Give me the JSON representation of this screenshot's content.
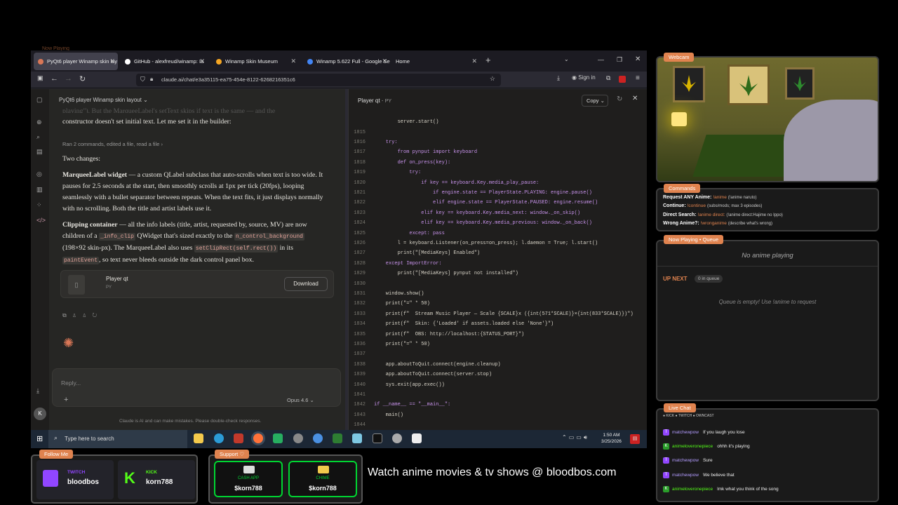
{
  "browser": {
    "tabs": [
      {
        "label": "PyQt6 player Winamp skin lay"
      },
      {
        "label": "GitHub - alexfreud/winamp: Ia"
      },
      {
        "label": "Winamp Skin Museum"
      },
      {
        "label": "Winamp 5.622 Full - Google Se"
      },
      {
        "label": "Home"
      }
    ],
    "url": "claude.ai/chat/e3a35115-ea75-454e-8122-6268216351c6",
    "sign_in": "Sign in",
    "new_tab": "+"
  },
  "claude": {
    "title": "PyQt6 player Winamp skin layout",
    "intro_line1": "playing\"). But the MarqueeLabel's setText skips if text is the same — and the",
    "intro_line2": "constructor doesn't set initial text. Let me set it in the builder:",
    "tool_summary": "Ran 2 commands, edited a file, read a file",
    "two_changes": "Two changes:",
    "p1_head": "MarqueeLabel widget",
    "p1_body": " — a custom QLabel subclass that auto-scrolls when text is too wide. It pauses for 2.5 seconds at the start, then smoothly scrolls at 1px per tick (20fps), looping seamlessly with a bullet separator between repeats. When the text fits, it just displays normally with no scrolling. Both the title and artist labels use it.",
    "p2_head": "Clipping container",
    "p2_a": " — all the info labels (title, artist, requested by, source, MV) are now children of a ",
    "p2_code1": "_info_clip",
    "p2_b": " QWidget that's sized exactly to the ",
    "p2_code2": "n_control_background",
    "p2_c": " (198×92 skin-px). The MarqueeLabel also uses ",
    "p2_code3": "setClipRect(self.rect())",
    "p2_d": " in its ",
    "p2_code4": "paintEvent",
    "p2_e": ", so text never bleeds outside the dark control panel box.",
    "file_name": "Player qt",
    "file_type": "PY",
    "download": "Download",
    "reply_placeholder": "Reply...",
    "model": "Opus 4.6",
    "disclaimer": "Claude is AI and can make mistakes. Please double-check responses."
  },
  "code_pane": {
    "title": "Player qt",
    "type": "PY",
    "copy": "Copy",
    "lines": [
      {
        "n": "",
        "t": "        server.start()"
      },
      {
        "n": "1815",
        "t": ""
      },
      {
        "n": "1816",
        "t": "    try:"
      },
      {
        "n": "1817",
        "t": "        from pynput import keyboard"
      },
      {
        "n": "1818",
        "t": "        def on_press(key):"
      },
      {
        "n": "1819",
        "t": "            try:"
      },
      {
        "n": "1820",
        "t": "                if key == keyboard.Key.media_play_pause:"
      },
      {
        "n": "1821",
        "t": "                    if engine.state == PlayerState.PLAYING: engine.pause()"
      },
      {
        "n": "1822",
        "t": "                    elif engine.state == PlayerState.PAUSED: engine.resume()"
      },
      {
        "n": "1823",
        "t": "                elif key == keyboard.Key.media_next: window._on_skip()"
      },
      {
        "n": "1824",
        "t": "                elif key == keyboard.Key.media_previous: window._on_back()"
      },
      {
        "n": "1825",
        "t": "            except: pass"
      },
      {
        "n": "1826",
        "t": "        l = keyboard.Listener(on_press=on_press); l.daemon = True; l.start()"
      },
      {
        "n": "1827",
        "t": "        print(\"[MediaKeys] Enabled\")"
      },
      {
        "n": "1828",
        "t": "    except ImportError:"
      },
      {
        "n": "1829",
        "t": "        print(\"[MediaKeys] pynput not installed\")"
      },
      {
        "n": "1830",
        "t": ""
      },
      {
        "n": "1831",
        "t": "    window.show()"
      },
      {
        "n": "1832",
        "t": "    print(\"=\" * 50)"
      },
      {
        "n": "1833",
        "t": "    print(f\"  Stream Music Player — Scale {SCALE}x ({int(571*SCALE)}×{int(833*SCALE)})\")"
      },
      {
        "n": "1834",
        "t": "    print(f\"  Skin: {'Loaded' if assets.loaded else 'None'}\")"
      },
      {
        "n": "1835",
        "t": "    print(f\"  OBS: http://localhost:{STATUS_PORT}\")"
      },
      {
        "n": "1836",
        "t": "    print(\"=\" * 50)"
      },
      {
        "n": "1837",
        "t": ""
      },
      {
        "n": "1838",
        "t": "    app.aboutToQuit.connect(engine.cleanup)"
      },
      {
        "n": "1839",
        "t": "    app.aboutToQuit.connect(server.stop)"
      },
      {
        "n": "1840",
        "t": "    sys.exit(app.exec())"
      },
      {
        "n": "1841",
        "t": ""
      },
      {
        "n": "1842",
        "t": "if __name__ == \"__main__\":"
      },
      {
        "n": "1843",
        "t": "    main()"
      },
      {
        "n": "1844",
        "t": ""
      }
    ]
  },
  "taskbar": {
    "search": "Type here to search",
    "time": "1:50 AM",
    "date": "3/25/2026"
  },
  "overlay": {
    "webcam_tag": "Webcam",
    "commands_tag": "Commands",
    "commands": [
      {
        "label": "Request ANY Anime:",
        "cmd": "!anime",
        "desc": "(!anime naruto)"
      },
      {
        "label": "Continue:",
        "cmd": "!continue",
        "desc": "(subs/mods; max 3 episodes)"
      },
      {
        "label": "Direct Search:",
        "cmd": "!anime direct:",
        "desc": "(!anime direct:Hajime no Ippo)"
      },
      {
        "label": "Wrong Anime?:",
        "cmd": "!wronganime",
        "desc": "(describe what's wrong)"
      }
    ],
    "now_playing_tag": "Now Playing • Queue",
    "now_playing": "No anime playing",
    "up_next": "UP NEXT",
    "queue_count": "0 in queue",
    "queue_empty": "Queue is empty! Use !anime to request",
    "live_chat_tag": "Live Chat",
    "chat_sources": "● KICK  ● TWITCH  ● OWNCAST",
    "chat": [
      {
        "platform": "twitch",
        "user": "matchewpow",
        "msg": "If you laugh you lose"
      },
      {
        "platform": "kick",
        "user": "animeloveronepiece",
        "msg": "ohhh it's playing"
      },
      {
        "platform": "twitch",
        "user": "matchewpow",
        "msg": "Sure"
      },
      {
        "platform": "twitch",
        "user": "matchewpow",
        "msg": "We believe that"
      },
      {
        "platform": "kick",
        "user": "animeloveronepiece",
        "msg": "lmk what you think of the song"
      }
    ],
    "follow_tag": "Follow Me",
    "twitch_label": "TWITCH",
    "twitch_user": "bloodbos",
    "kick_label": "KICK",
    "kick_user": "korn788",
    "support_tag": "Support ♡",
    "cashapp_label": "CASH APP",
    "cashapp_user": "$korn788",
    "chime_label": "CHIME",
    "chime_user": "$korn788",
    "banner": "Watch anime movies & tv shows @ bloodbos.com",
    "top_tag": "Now Playing"
  },
  "colors": {
    "accent": "#e0834f",
    "twitch": "#9146ff",
    "kick": "#53fc18",
    "cashapp": "#00d632"
  }
}
